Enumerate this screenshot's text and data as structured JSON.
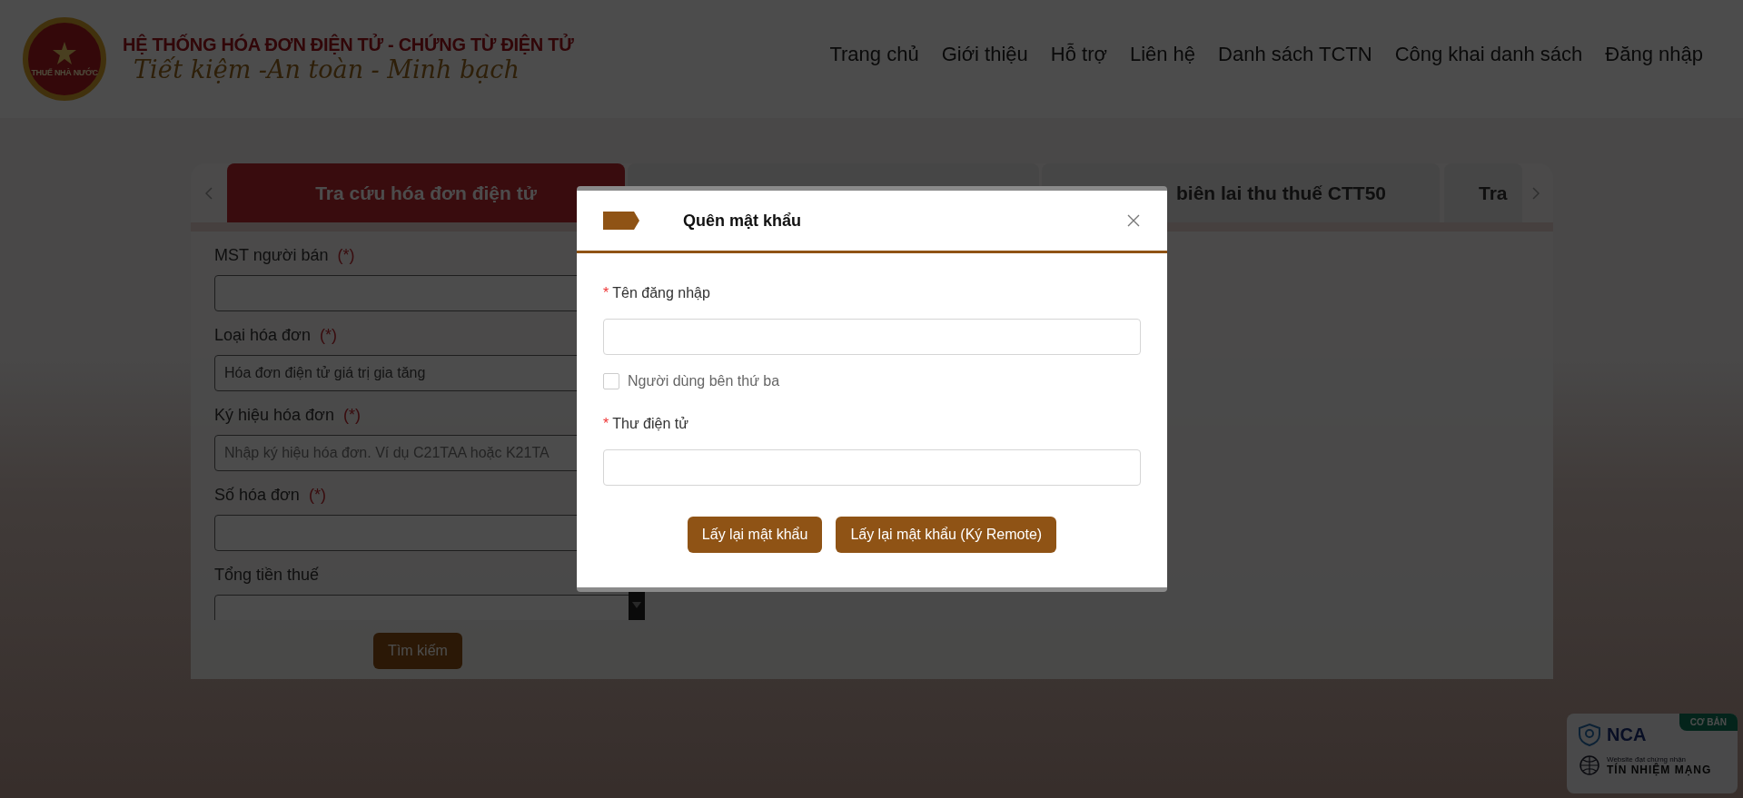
{
  "header": {
    "logo_text": "THUẾ NHÀ NƯỚC",
    "title": "HỆ THỐNG HÓA ĐƠN ĐIỆN TỬ - CHỨNG TỪ ĐIỆN TỬ",
    "slogan": "Tiết kiệm -An toàn - Minh bạch"
  },
  "nav": [
    {
      "label": "Trang chủ"
    },
    {
      "label": "Giới thiệu"
    },
    {
      "label": "Hỗ trợ"
    },
    {
      "label": "Liên hệ"
    },
    {
      "label": "Danh sách TCTN"
    },
    {
      "label": "Công khai danh sách"
    },
    {
      "label": "Đăng nhập"
    }
  ],
  "tabs": [
    {
      "label": "Tra cứu hóa đơn điện tử",
      "selected": true
    },
    {
      "selected": false
    },
    {
      "label": "biên lai thu thuế CTT50",
      "selected": false
    },
    {
      "label": "Tra",
      "selected": false
    }
  ],
  "search_form": {
    "fields": [
      {
        "label": "MST người bán",
        "required_mark": "(*)"
      },
      {
        "label": "Loại hóa đơn",
        "required_mark": "(*)",
        "value": "Hóa đơn điện tử giá trị gia tăng"
      },
      {
        "label": "Ký hiệu hóa đơn",
        "required_mark": "(*)",
        "placeholder": "Nhập ký hiệu hóa đơn. Ví dụ C21TAA hoặc K21TA"
      },
      {
        "label": "Số hóa đơn",
        "required_mark": "(*)"
      },
      {
        "label": "Tổng tiền thuế"
      }
    ],
    "button": "Tìm kiếm"
  },
  "modal": {
    "title": "Quên mật khẩu",
    "fields": [
      {
        "kind": "input",
        "label": "Tên đăng nhập",
        "required_mark": "*"
      },
      {
        "kind": "checkbox",
        "label": "Người dùng bên thứ ba",
        "checked": false
      },
      {
        "kind": "input",
        "label": "Thư điện tử",
        "required_mark": "*"
      }
    ],
    "buttons": [
      "Lấy lại mật khẩu",
      "Lấy lại mật khẩu (Ký Remote)"
    ]
  },
  "certification_badge": {
    "tier": "CƠ BẢN",
    "brand": "NCA",
    "caption": "Website đạt chứng nhận",
    "title": "TÍN NHIỆM MẠNG"
  }
}
